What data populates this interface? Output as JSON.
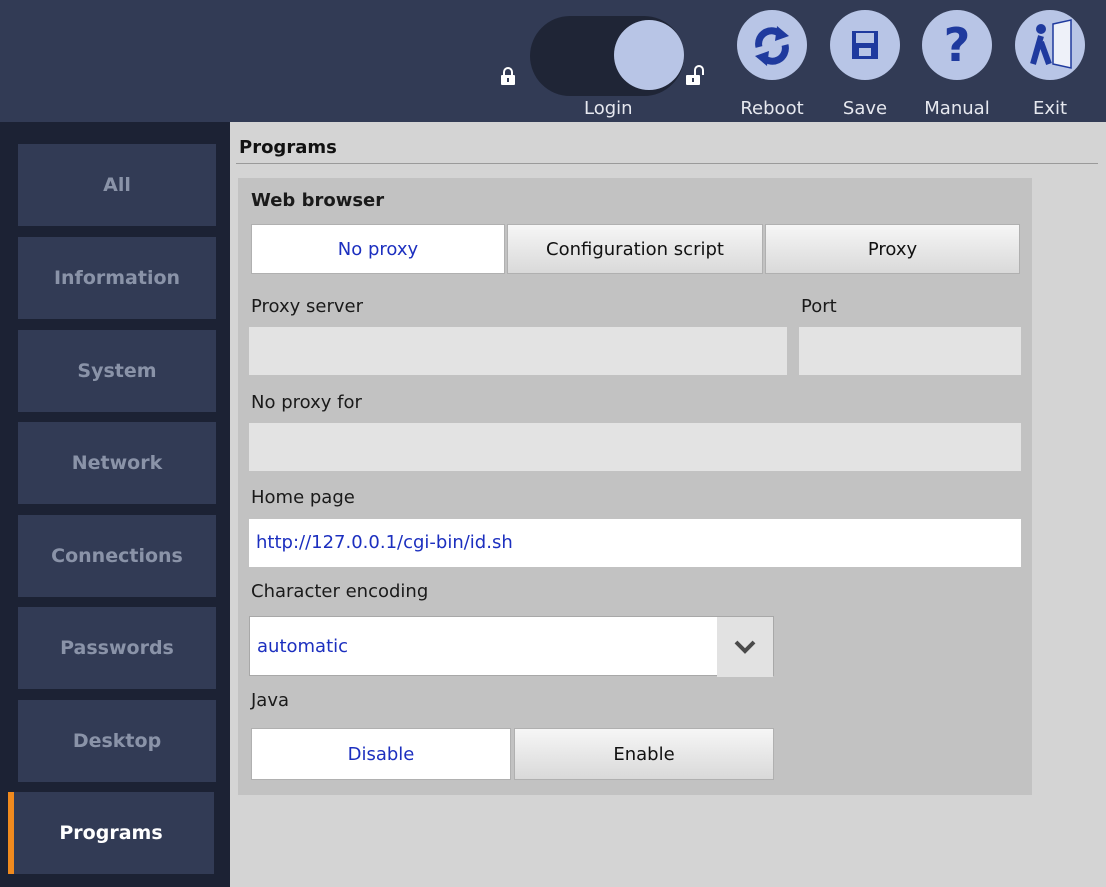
{
  "header": {
    "login_label": "Login",
    "buttons": [
      {
        "label": "Reboot",
        "icon": "reboot-icon"
      },
      {
        "label": "Save",
        "icon": "floppy-icon"
      },
      {
        "label": "Manual",
        "icon": "help-icon"
      },
      {
        "label": "Exit",
        "icon": "exit-door-icon"
      }
    ]
  },
  "sidebar": {
    "items": [
      {
        "label": "All"
      },
      {
        "label": "Information"
      },
      {
        "label": "System"
      },
      {
        "label": "Network"
      },
      {
        "label": "Connections"
      },
      {
        "label": "Passwords"
      },
      {
        "label": "Desktop"
      },
      {
        "label": "Programs",
        "active": true
      }
    ]
  },
  "main": {
    "title": "Programs",
    "web_browser": {
      "heading": "Web browser",
      "proxy_modes": [
        "No proxy",
        "Configuration script",
        "Proxy"
      ],
      "proxy_mode_selected": "No proxy",
      "proxy_server_label": "Proxy server",
      "proxy_server_value": "",
      "port_label": "Port",
      "port_value": "",
      "no_proxy_label": "No proxy for",
      "no_proxy_value": "",
      "home_page_label": "Home page",
      "home_page_value": "http://127.0.0.1/cgi-bin/id.sh",
      "encoding_label": "Character encoding",
      "encoding_value": "automatic",
      "java_label": "Java",
      "java_options": [
        "Disable",
        "Enable"
      ],
      "java_selected": "Disable"
    }
  },
  "colors": {
    "header_bg": "#323b55",
    "sidebar_bg": "#1c2234",
    "accent": "#f08a1e",
    "selected_text": "#1c2fbf",
    "button_circle": "#b8c5e6"
  }
}
